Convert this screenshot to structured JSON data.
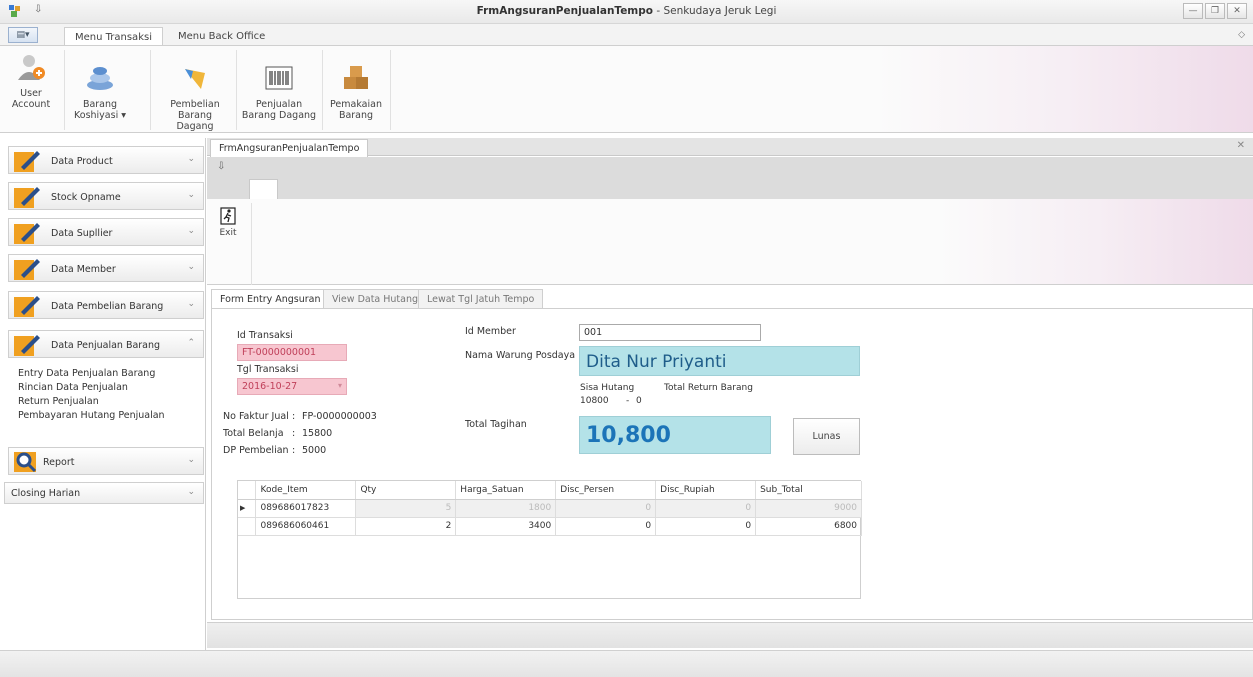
{
  "window": {
    "title_bold": "FrmAngsuranPenjualanTempo",
    "title_rest": " - Senkudaya Jeruk Legi",
    "quick_access": "⇩",
    "btn_minimize": "—",
    "btn_restore": "❐",
    "btn_close": "✕"
  },
  "ribbon_tabs": {
    "app_menu": "▤▾",
    "tabs": [
      "Menu Transaksi",
      "Menu Back Office"
    ],
    "collapse": "◇"
  },
  "ribbon": {
    "buttons": [
      "User Account",
      "Barang\nKoshiyasi ▾",
      "Pembelian\nBarang Dagang",
      "Penjualan\nBarang Dagang",
      "Pemakaian\nBarang"
    ]
  },
  "sidebar": {
    "groups": [
      "Data Product",
      "Stock Opname",
      "Data Supllier",
      "Data Member",
      "Data Pembelian Barang",
      "Data Penjualan Barang",
      "Report",
      "Closing Harian"
    ],
    "sub_items": [
      "Entry Data Penjualan Barang",
      "Rincian Data Penjualan",
      "Return Penjualan",
      "Pembayaran Hutang Penjualan"
    ]
  },
  "document": {
    "tab_label": "FrmAngsuranPenjualanTempo",
    "close": "✕",
    "quick_access": "⇩",
    "exit_label": "Exit"
  },
  "form_tabs": [
    "Form Entry Angsuran",
    "View Data Hutang",
    "Lewat Tgl Jatuh Tempo"
  ],
  "form": {
    "id_transaksi_label": "Id Transaksi",
    "id_transaksi_value": "FT-0000000001",
    "tgl_transaksi_label": "Tgl Transaksi",
    "tgl_transaksi_value": "2016-10-27",
    "no_faktur_label": "No Faktur Jual",
    "no_faktur_value": "FP-0000000003",
    "total_belanja_label": "Total Belanja",
    "total_belanja_value": "15800",
    "dp_label": "DP Pembelian",
    "dp_value": "5000",
    "colon": ":",
    "id_member_label": "Id Member",
    "id_member_value": "001",
    "nama_label": "Nama Warung Posdaya",
    "nama_value": "Dita Nur Priyanti",
    "sisa_hutang_label": "Sisa Hutang",
    "sisa_hutang_value": "10800",
    "minus": "-",
    "total_return_label": "Total Return Barang",
    "total_return_value": "0",
    "total_tagihan_label": "Total Tagihan",
    "total_tagihan_value": "10,800",
    "lunas_label": "Lunas"
  },
  "grid": {
    "columns": [
      "Kode_Item",
      "Qty",
      "Harga_Satuan",
      "Disc_Persen",
      "Disc_Rupiah",
      "Sub_Total"
    ],
    "rows": [
      [
        "089686017823",
        "5",
        "1800",
        "0",
        "0",
        "9000"
      ],
      [
        "089686060461",
        "2",
        "3400",
        "0",
        "0",
        "6800"
      ]
    ],
    "row_indicator": "▶"
  },
  "colors": {
    "pink_field": "#f7c6d0",
    "cyan_field": "#b4e2e8"
  }
}
